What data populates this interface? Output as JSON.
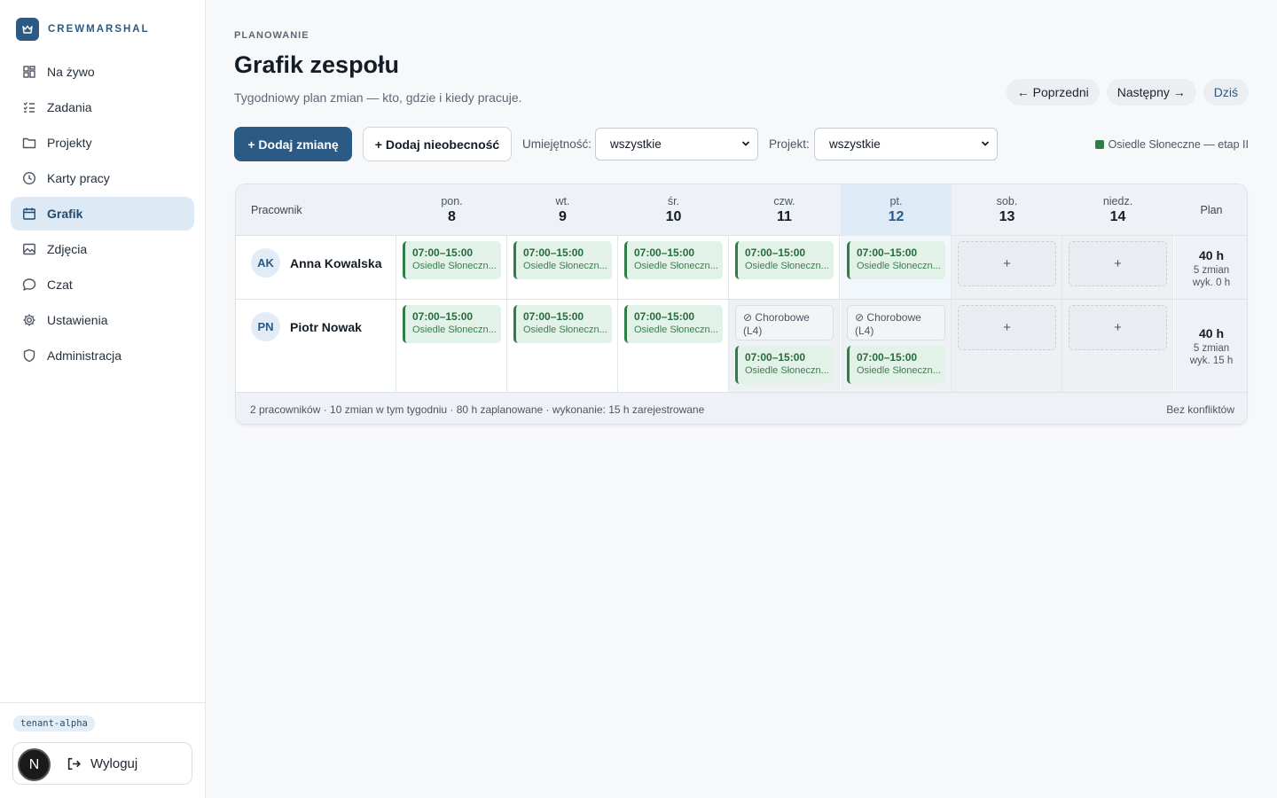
{
  "brand": {
    "name": "CREWMARSHAL"
  },
  "sidebar": {
    "items": [
      {
        "label": "Na żywo",
        "icon": "dashboard-icon"
      },
      {
        "label": "Zadania",
        "icon": "tasks-icon"
      },
      {
        "label": "Projekty",
        "icon": "folder-icon"
      },
      {
        "label": "Karty pracy",
        "icon": "clock-icon"
      },
      {
        "label": "Grafik",
        "icon": "calendar-icon",
        "active": true
      },
      {
        "label": "Zdjęcia",
        "icon": "image-icon"
      },
      {
        "label": "Czat",
        "icon": "chat-icon"
      },
      {
        "label": "Ustawienia",
        "icon": "gear-icon"
      },
      {
        "label": "Administracja",
        "icon": "shield-icon"
      }
    ],
    "tenant": "tenant-alpha",
    "user_initial": "N",
    "logout_label": "Wyloguj"
  },
  "header": {
    "kicker": "PLANOWANIE",
    "title": "Grafik zespołu",
    "subtitle": "Tygodniowy plan zmian — kto, gdzie i kiedy pracuje.",
    "prev_label": "← Poprzedni",
    "next_label": "Następny →",
    "today_label": "Dziś"
  },
  "toolbar": {
    "add_shift_label": "+ Dodaj zmianę",
    "add_absence_label": "+ Dodaj nieobecność",
    "skill_label": "Umiejętność:",
    "skill_value": "wszystkie",
    "project_label": "Projekt:",
    "project_value": "wszystkie",
    "legend_label": "Osiedle Słoneczne — etap II",
    "legend_color": "#2f7d47"
  },
  "grid": {
    "employee_header": "Pracownik",
    "plan_header": "Plan",
    "days": [
      {
        "name": "pon.",
        "date": "8"
      },
      {
        "name": "wt.",
        "date": "9"
      },
      {
        "name": "śr.",
        "date": "10"
      },
      {
        "name": "czw.",
        "date": "11"
      },
      {
        "name": "pt.",
        "date": "12",
        "today": true
      },
      {
        "name": "sob.",
        "date": "13"
      },
      {
        "name": "niedz.",
        "date": "14"
      }
    ],
    "rows": [
      {
        "initials": "AK",
        "name": "Anna Kowalska",
        "plan_hours": "40 h",
        "plan_shifts": "5 zmian",
        "plan_done": "wyk. 0 h"
      },
      {
        "initials": "PN",
        "name": "Piotr Nowak",
        "plan_hours": "40 h",
        "plan_shifts": "5 zmian",
        "plan_done": "wyk. 15 h"
      }
    ],
    "shift_time": "07:00–15:00",
    "shift_project": "Osiedle Słoneczn...",
    "absence_label": "Chorobowe",
    "absence_code": "(L4)",
    "add_symbol": "+"
  },
  "footer": {
    "summary": "2 pracowników · 10 zmian w tym tygodniu · 80 h zaplanowane · wykonanie: 15 h zarejestrowane",
    "conflicts": "Bez konfliktów"
  }
}
